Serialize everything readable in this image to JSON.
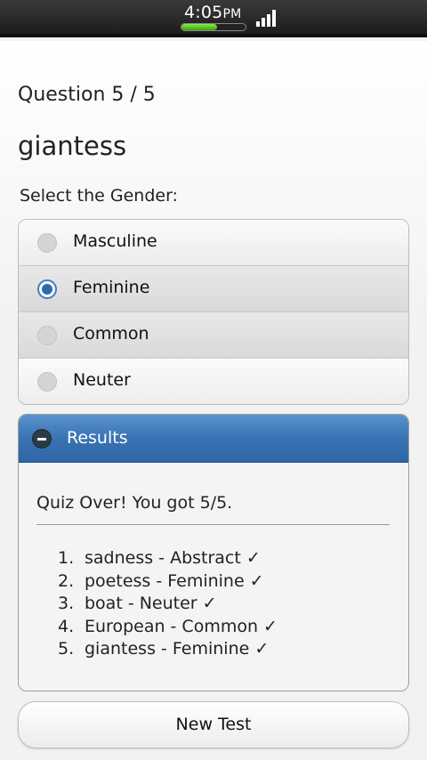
{
  "status_bar": {
    "time": "4:05",
    "ampm": "PM",
    "battery_level": 0.55
  },
  "quiz": {
    "counter": "Question 5 / 5",
    "word": "giantess",
    "prompt": "Select the Gender:",
    "options": [
      {
        "label": "Masculine",
        "selected": false
      },
      {
        "label": "Feminine",
        "selected": true
      },
      {
        "label": "Common",
        "selected": false
      },
      {
        "label": "Neuter",
        "selected": false
      }
    ]
  },
  "results": {
    "title": "Results",
    "summary": "Quiz Over! You got 5/5.",
    "items": [
      {
        "num": "1.",
        "text": "sadness - Abstract",
        "mark": "✓"
      },
      {
        "num": "2.",
        "text": "poetess - Feminine",
        "mark": "✓"
      },
      {
        "num": "3.",
        "text": "boat - Neuter",
        "mark": "✓"
      },
      {
        "num": "4.",
        "text": "European - Common",
        "mark": "✓"
      },
      {
        "num": "5.",
        "text": "giantess - Feminine",
        "mark": "✓"
      }
    ]
  },
  "new_test_label": "New Test",
  "colors": {
    "accent": "#3a73b3",
    "radio_on": "#2f6aab"
  }
}
